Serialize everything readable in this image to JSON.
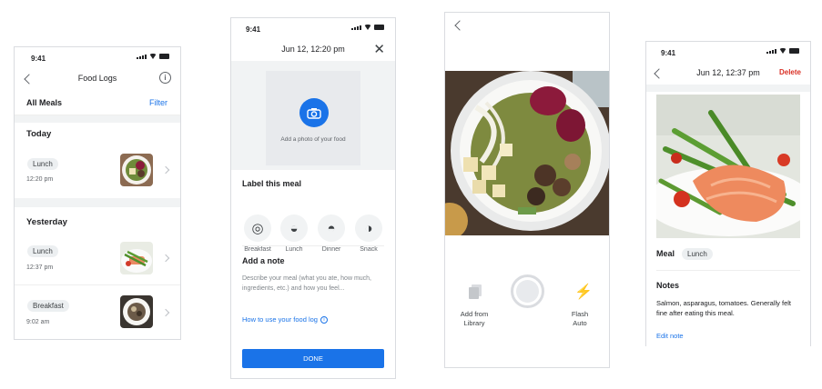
{
  "screen1": {
    "time": "9:41",
    "title": "Food Logs",
    "all_meals": "All Meals",
    "filter": "Filter",
    "groups": [
      {
        "heading": "Today",
        "entries": [
          {
            "tag": "Lunch",
            "time": "12:20 pm"
          }
        ]
      },
      {
        "heading": "Yesterday",
        "entries": [
          {
            "tag": "Lunch",
            "time": "12:37 pm"
          },
          {
            "tag": "Breakfast",
            "time": "9:02 am"
          }
        ]
      }
    ]
  },
  "screen2": {
    "time": "9:41",
    "title": "Jun 12, 12:20 pm",
    "add_photo": "Add a photo of your food",
    "label_heading": "Label this meal",
    "meals": [
      "Breakfast",
      "Lunch",
      "Dinner",
      "Snack"
    ],
    "note_heading": "Add a note",
    "note_placeholder": "Describe your meal (what you ate, how much, ingredients, etc.) and how you feel...",
    "help_link": "How to use your food log",
    "done": "DONE"
  },
  "screen3": {
    "add_library": "Add from Library",
    "flash": "Flash",
    "flash_mode": "Auto"
  },
  "screen4": {
    "time": "9:41",
    "title": "Jun 12, 12:37 pm",
    "delete": "Delete",
    "meal_label": "Meal",
    "meal_tag": "Lunch",
    "notes_heading": "Notes",
    "notes_text": "Salmon, asparagus, tomatoes. Generally felt fine after eating this meal.",
    "edit_note": "Edit note"
  },
  "colors": {
    "accent": "#1a73e8",
    "delete": "#d93025",
    "done_button": "#1a73e8"
  }
}
